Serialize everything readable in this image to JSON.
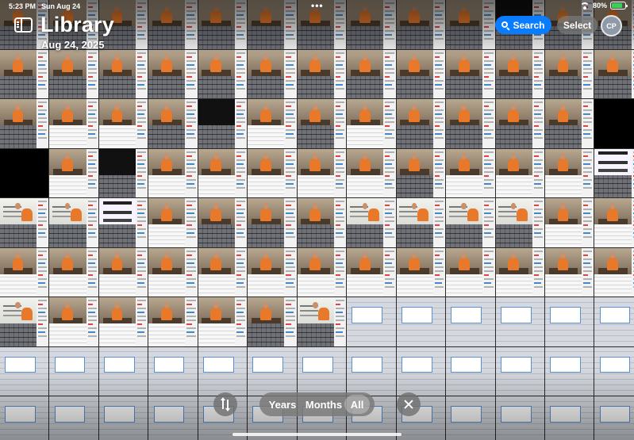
{
  "status_bar": {
    "time": "5:23 PM",
    "date": "Sun Aug 24",
    "battery_percent": "80%",
    "battery_level": 0.8,
    "multitasking_dots": "•••"
  },
  "header": {
    "title": "Library",
    "date": "Aug 24, 2025",
    "search_label": "Search",
    "select_label": "Select",
    "avatar_initials": "CP"
  },
  "view_switcher": {
    "options": [
      "Years",
      "Months",
      "All"
    ],
    "selected": "All"
  },
  "colors": {
    "accent": "#0a7cff",
    "battery_fill": "#36d05a"
  },
  "icons": [
    "sidebar-icon",
    "search-icon",
    "sort-icon",
    "close-icon",
    "wifi-icon",
    "battery-icon"
  ],
  "grid": {
    "columns": 13,
    "rows": 9,
    "thumbnail_types": [
      "kb",
      "kb",
      "kb",
      "kb",
      "kb",
      "kb",
      "kb",
      "kb",
      "kb",
      "kb",
      "dark",
      "kb",
      "kb",
      "kb",
      "kb",
      "kb",
      "kb",
      "kb",
      "kb",
      "kb",
      "kb",
      "kb",
      "kb",
      "kb",
      "kb",
      "kb",
      "kb",
      "text",
      "text",
      "kb",
      "dark",
      "text",
      "kb",
      "text",
      "kb",
      "kb",
      "kb",
      "kb",
      "black",
      "black",
      "text",
      "dark",
      "text",
      "text",
      "text",
      "text",
      "text",
      "kb",
      "text",
      "text",
      "text",
      "sign",
      "board",
      "board",
      "sign",
      "text",
      "kb",
      "kb",
      "kb",
      "board",
      "board",
      "board",
      "board",
      "text",
      "text",
      "text",
      "text",
      "text",
      "text",
      "text",
      "text",
      "text",
      "text",
      "text",
      "text",
      "text",
      "text",
      "text",
      "board",
      "text",
      "text",
      "text",
      "text",
      "kb",
      "board",
      "app",
      "app",
      "app",
      "app",
      "app",
      "app",
      "app",
      "app",
      "app",
      "app",
      "app",
      "app",
      "app",
      "app",
      "app",
      "app",
      "app",
      "app",
      "app",
      "app",
      "app",
      "app",
      "app",
      "app",
      "app",
      "app",
      "app",
      "app",
      "app",
      "app",
      "app",
      "app"
    ]
  }
}
